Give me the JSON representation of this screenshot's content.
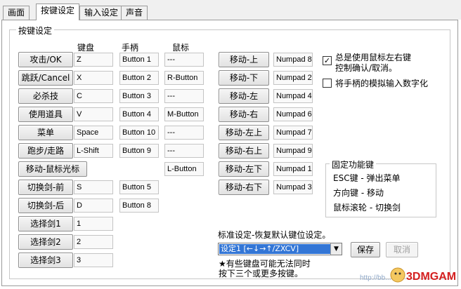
{
  "tabs": [
    "画面",
    "按键设定",
    "输入设定",
    "声音"
  ],
  "group": {
    "title": "按键设定",
    "headers": {
      "keyboard": "键盘",
      "gamepad": "手柄",
      "mouse": "鼠标"
    }
  },
  "actions": [
    {
      "label": "攻击/OK",
      "keyboard": "Z",
      "gamepad": "Button 1",
      "mouse": "---"
    },
    {
      "label": "跳跃/Cancel",
      "keyboard": "X",
      "gamepad": "Button 2",
      "mouse": "R-Button"
    },
    {
      "label": "必杀技",
      "keyboard": "C",
      "gamepad": "Button 3",
      "mouse": "---"
    },
    {
      "label": "使用道具",
      "keyboard": "V",
      "gamepad": "Button 4",
      "mouse": "M-Button"
    },
    {
      "label": "菜单",
      "keyboard": "Space",
      "gamepad": "Button 10",
      "mouse": "---"
    },
    {
      "label": "跑步/走路",
      "keyboard": "L-Shift",
      "gamepad": "Button 9",
      "mouse": "---"
    },
    {
      "label": "移动-鼠标光标",
      "mouse": "L-Button"
    },
    {
      "label": "切换剑-前",
      "keyboard": "S",
      "gamepad": "Button 5"
    },
    {
      "label": "切换剑-后",
      "keyboard": "D",
      "gamepad": "Button 8"
    },
    {
      "label": "选择剑1",
      "keyboard": "1"
    },
    {
      "label": "选择剑2",
      "keyboard": "2"
    },
    {
      "label": "选择剑3",
      "keyboard": "3"
    }
  ],
  "moves": [
    {
      "label": "移动-上",
      "key": "Numpad 8"
    },
    {
      "label": "移动-下",
      "key": "Numpad 2"
    },
    {
      "label": "移动-左",
      "key": "Numpad 4"
    },
    {
      "label": "移动-右",
      "key": "Numpad 6"
    },
    {
      "label": "移动-左上",
      "key": "Numpad 7"
    },
    {
      "label": "移动-右上",
      "key": "Numpad 9"
    },
    {
      "label": "移动-左下",
      "key": "Numpad 1"
    },
    {
      "label": "移动-右下",
      "key": "Numpad 3"
    }
  ],
  "options": {
    "mouse_lr": {
      "line1": "总是使用鼠标左右键",
      "line2": "控制确认/取消。",
      "checked": true,
      "mark": "✓"
    },
    "analog": {
      "label": "将手柄的模拟输入数字化",
      "checked": false
    }
  },
  "fixed_keys": {
    "title": "固定功能键",
    "lines": [
      "ESC键 - 弹出菜单",
      "方向键 - 移动",
      "鼠标滚轮 - 切换剑"
    ]
  },
  "preset": {
    "label": "标准设定-恢复默认键位设定。",
    "value": "设定1 [←↓→↑/ZXCV]",
    "save": "保存",
    "cancel": "取消",
    "note_line1": "★有些键盘可能无法同时",
    "note_line2": "按下三个或更多按键。"
  },
  "watermark": {
    "text": "3DMGAME",
    "partial": "http://bb..."
  },
  "colors": {
    "selection": "#3376d6",
    "watermark": "#d42020"
  }
}
